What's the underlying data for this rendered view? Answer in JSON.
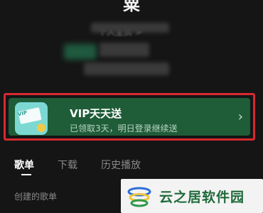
{
  "profile": {
    "name": "粟",
    "subtitle": "个人主页 >"
  },
  "vip_banner": {
    "title": "VIP天天送",
    "description": "已领取3天，明日登录继续送",
    "badge_text": "VIP",
    "arrow_icon": "chevron-right-icon"
  },
  "tabs": [
    {
      "label": "歌单",
      "active": true
    },
    {
      "label": "下载",
      "active": false
    },
    {
      "label": "历史播放",
      "active": false
    }
  ],
  "section": {
    "created_playlists": "创建的歌单"
  },
  "watermark": {
    "text": "云之居软件园"
  },
  "colors": {
    "background": "#151515",
    "vip_card": "#1f5c38",
    "highlight_border": "#d62a2f"
  }
}
